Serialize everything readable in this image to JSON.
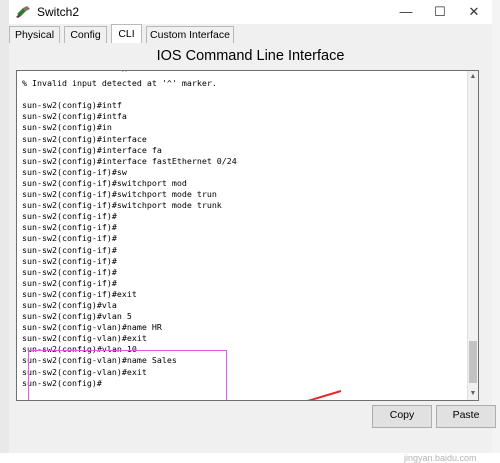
{
  "window": {
    "title": "Switch2",
    "minimize_glyph": "—",
    "maximize_glyph": "☐",
    "close_glyph": "✕"
  },
  "tabs": [
    {
      "label": "Physical",
      "active": false
    },
    {
      "label": "Config",
      "active": false
    },
    {
      "label": "CLI",
      "active": true
    },
    {
      "label": "Custom Interface",
      "active": false
    }
  ],
  "heading": "IOS Command Line Interface",
  "terminal": {
    "lines": [
      "                    ^",
      "% Invalid input detected at '^' marker.",
      "",
      "sun-sw2(config)#intf",
      "sun-sw2(config)#intfa",
      "sun-sw2(config)#in",
      "sun-sw2(config)#interface",
      "sun-sw2(config)#interface fa",
      "sun-sw2(config)#interface fastEthernet 0/24",
      "sun-sw2(config-if)#sw",
      "sun-sw2(config-if)#switchport mod",
      "sun-sw2(config-if)#switchport mode trun",
      "sun-sw2(config-if)#switchport mode trunk",
      "sun-sw2(config-if)#",
      "sun-sw2(config-if)#",
      "sun-sw2(config-if)#",
      "sun-sw2(config-if)#",
      "sun-sw2(config-if)#",
      "sun-sw2(config-if)#",
      "sun-sw2(config-if)#",
      "sun-sw2(config-if)#exit",
      "sun-sw2(config)#vla",
      "sun-sw2(config)#vlan 5",
      "sun-sw2(config-vlan)#name HR",
      "sun-sw2(config-vlan)#exit",
      "sun-sw2(config)#vlan 10",
      "sun-sw2(config-vlan)#name Sales",
      "sun-sw2(config-vlan)#exit",
      "sun-sw2(config)#"
    ]
  },
  "buttons": {
    "copy": "Copy",
    "paste": "Paste"
  },
  "watermark": "jingyan.baidu.com",
  "colors": {
    "highlight_box": "#e15ae1",
    "arrow": "#e8262b"
  },
  "icons": {
    "app": "switch-icon",
    "scroll_up": "scroll-up-arrow-icon",
    "scroll_down": "scroll-down-arrow-icon"
  }
}
